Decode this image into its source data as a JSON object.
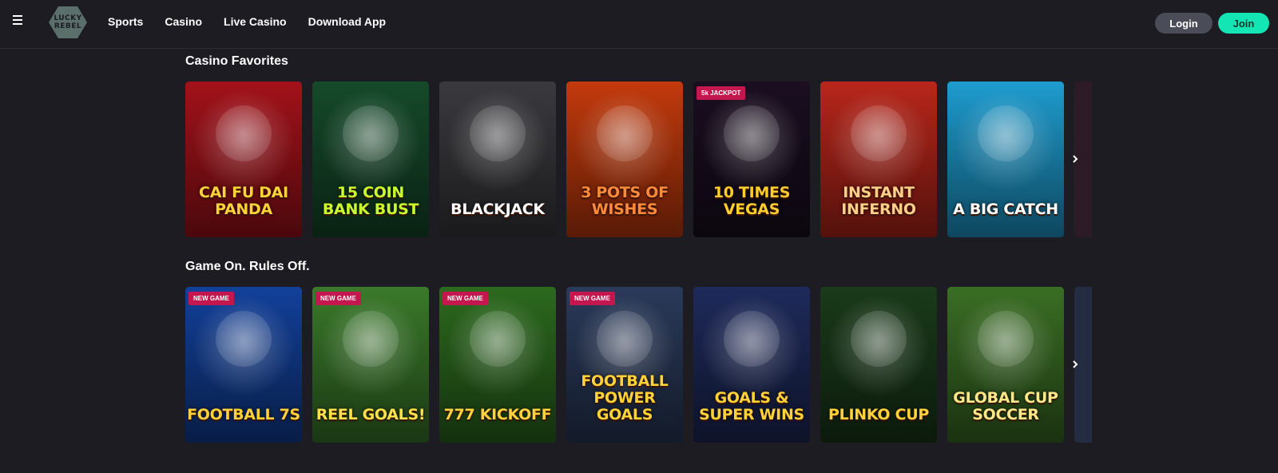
{
  "header": {
    "logo_line1": "LUCKY",
    "logo_line2": "REBEL",
    "nav": [
      "Sports",
      "Casino",
      "Live Casino",
      "Download App"
    ],
    "login_label": "Login",
    "join_label": "Join"
  },
  "sections": [
    {
      "title": "Casino Favorites",
      "games": [
        {
          "name": "Cai Fu Dai Panda",
          "badge": "",
          "name_color": "#ffd23a",
          "bg": "#a3121a"
        },
        {
          "name": "15 Coin Bank Bust",
          "badge": "",
          "name_color": "#c8ff2e",
          "bg": "#154a2a"
        },
        {
          "name": "Blackjack",
          "badge": "",
          "name_color": "#ffffff",
          "bg": "#3a3a3e"
        },
        {
          "name": "3 Pots of Wishes",
          "badge": "",
          "name_color": "#ff8a3a",
          "bg": "#c43a0c"
        },
        {
          "name": "10 Times Vegas",
          "badge": "5k JACKPOT",
          "name_color": "#ffcc2e",
          "bg": "#1a0e20"
        },
        {
          "name": "Instant Inferno",
          "badge": "",
          "name_color": "#ffcf8a",
          "bg": "#b8261a"
        },
        {
          "name": "A Big Catch",
          "badge": "",
          "name_color": "#ffffff",
          "bg": "#1e9ccf"
        }
      ]
    },
    {
      "title": "Game On. Rules Off.",
      "games": [
        {
          "name": "Football 7s",
          "badge": "NEW GAME",
          "name_color": "#ffd23a",
          "bg": "#12409a"
        },
        {
          "name": "Reel Goals!",
          "badge": "NEW GAME",
          "name_color": "#ffe14a",
          "bg": "#3a7a2a"
        },
        {
          "name": "777 Kickoff",
          "badge": "NEW GAME",
          "name_color": "#ffd23a",
          "bg": "#2c6a1e"
        },
        {
          "name": "Football Power Goals",
          "badge": "NEW GAME",
          "name_color": "#ffd23a",
          "bg": "#2a3a5a"
        },
        {
          "name": "Goals & Super Wins",
          "badge": "",
          "name_color": "#ffd23a",
          "bg": "#1e2a5a"
        },
        {
          "name": "Plinko Cup",
          "badge": "",
          "name_color": "#ffd23a",
          "bg": "#1a3a1a"
        },
        {
          "name": "Global Cup Soccer",
          "badge": "",
          "name_color": "#ffe88a",
          "bg": "#3a6e24"
        }
      ]
    }
  ],
  "icons": {
    "menu": "hamburger-icon",
    "next": "chevron-right-icon"
  },
  "colors": {
    "background": "#1c1c22",
    "join": "#13e6b4",
    "login": "#4a4c58",
    "badge": "#c4164f"
  }
}
